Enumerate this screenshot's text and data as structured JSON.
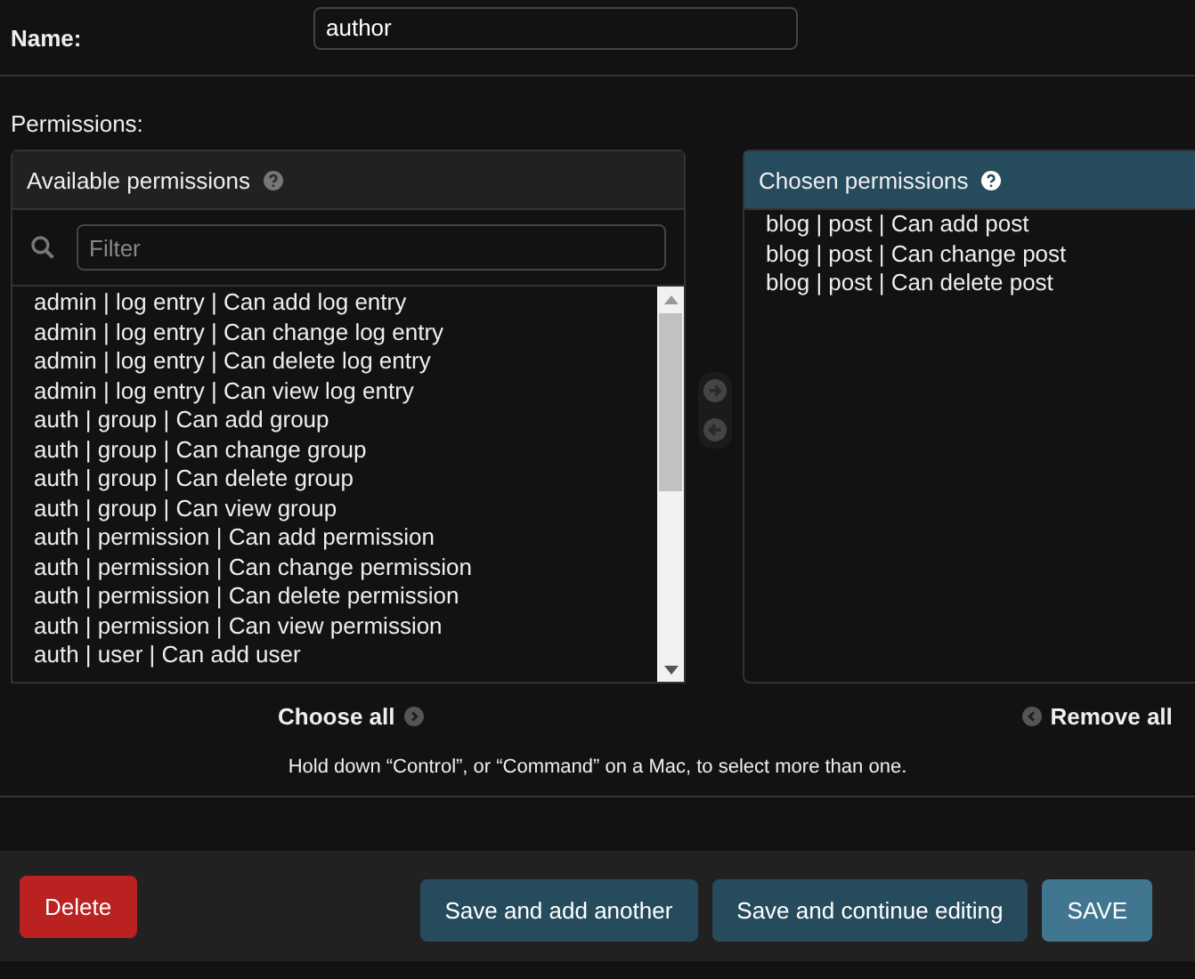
{
  "name_field": {
    "label": "Name:",
    "value": "author"
  },
  "permissions": {
    "label": "Permissions:",
    "available": {
      "title": "Available permissions",
      "filter_placeholder": "Filter",
      "items": [
        "admin | log entry | Can add log entry",
        "admin | log entry | Can change log entry",
        "admin | log entry | Can delete log entry",
        "admin | log entry | Can view log entry",
        "auth | group | Can add group",
        "auth | group | Can change group",
        "auth | group | Can delete group",
        "auth | group | Can view group",
        "auth | permission | Can add permission",
        "auth | permission | Can change permission",
        "auth | permission | Can delete permission",
        "auth | permission | Can view permission",
        "auth | user | Can add user"
      ],
      "choose_all": "Choose all"
    },
    "chosen": {
      "title": "Chosen permissions",
      "items": [
        "blog | post | Can add post",
        "blog | post | Can change post",
        "blog | post | Can delete post"
      ],
      "remove_all": "Remove all"
    },
    "help_text": "Hold down “Control”, or “Command” on a Mac, to select more than one."
  },
  "footer": {
    "delete": "Delete",
    "buttons": [
      {
        "label": "Save and add another",
        "kind": "secondary"
      },
      {
        "label": "Save and continue editing",
        "kind": "secondary"
      },
      {
        "label": "SAVE",
        "kind": "default"
      }
    ]
  }
}
